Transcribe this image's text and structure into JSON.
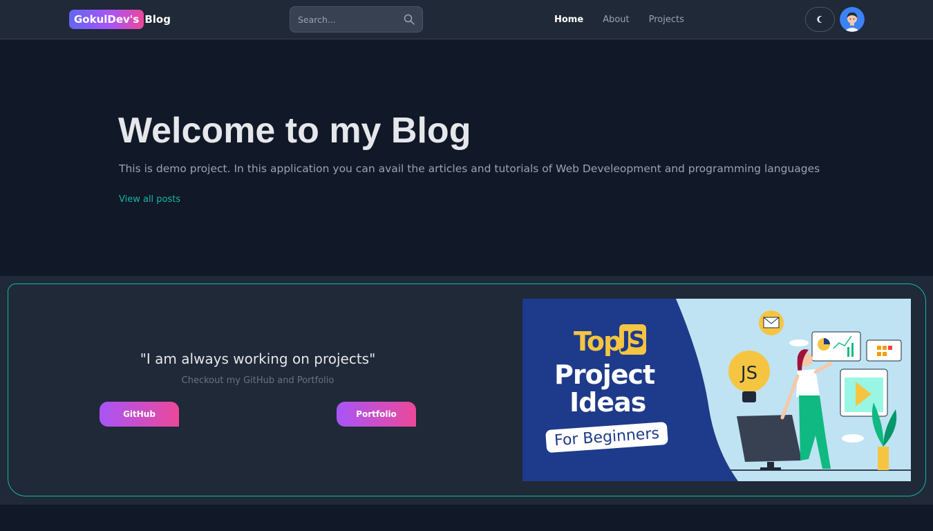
{
  "navbar": {
    "brand_pill": "GokulDev's",
    "brand_suffix": "Blog",
    "search_placeholder": "Search...",
    "search_value": "",
    "links": [
      "Home",
      "About",
      "Projects"
    ],
    "active_link": "Home"
  },
  "hero": {
    "title": "Welcome to my Blog",
    "subtitle": "This is demo project. In this application you can avail the articles and tutorials of Web Develeopment and programming languages",
    "link": "View all posts"
  },
  "cta": {
    "quote": "\"I am always working on projects\"",
    "subtitle": "Checkout my GitHub and Portfolio",
    "github_label": "GitHub",
    "portfolio_label": "Portfolio"
  },
  "banner": {
    "word_top": "Top",
    "word_js": "JS",
    "line_project": "Project",
    "line_ideas": "Ideas",
    "line_beginners": "For Beginners",
    "illustration_badge": "JS"
  },
  "colors": {
    "accent_teal": "#14b8a6",
    "gradient_start": "#a855f7",
    "gradient_end": "#ec4899",
    "page_bg": "#111827",
    "surface_bg": "#1f2937"
  },
  "icons": [
    "search-icon",
    "moon-icon",
    "avatar"
  ]
}
